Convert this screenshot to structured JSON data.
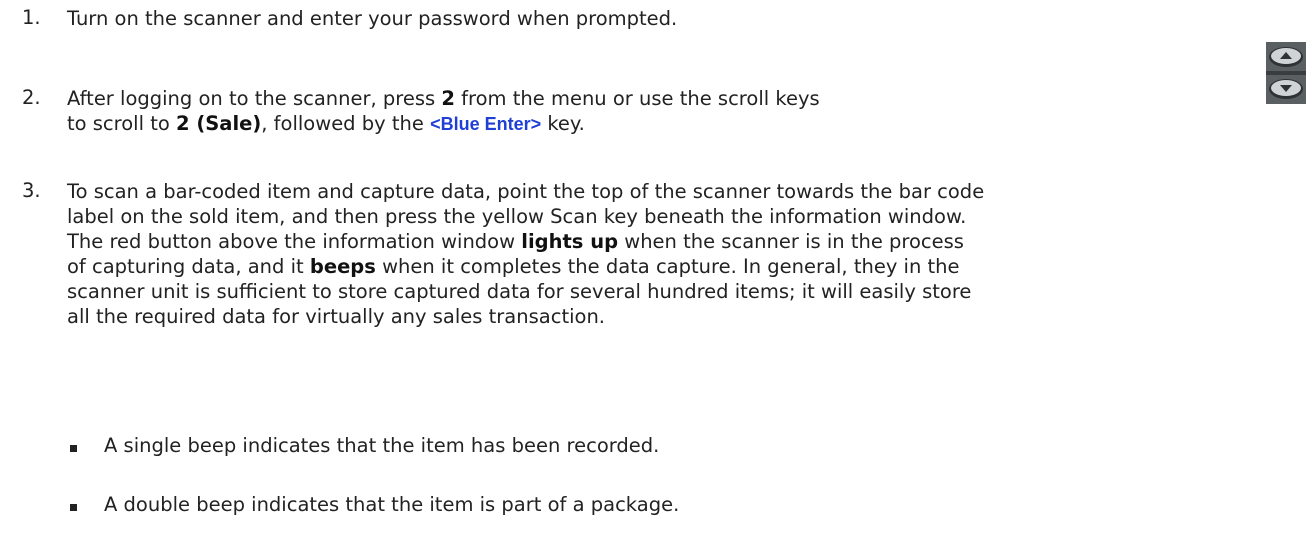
{
  "steps": [
    {
      "number": "1.",
      "lines": [
        "Turn on the scanner and enter your password when prompted."
      ]
    },
    {
      "number": "2.",
      "line1": "After logging on to the scanner, press ",
      "line1_bold": "2",
      "line1_end": " from the menu or use the scroll keys",
      "line2_a": "to scroll to ",
      "line2_bold": "2 (Sale)",
      "line2_b": ", followed by the ",
      "line2_blue": "<Blue Enter>",
      "line2_c": " key."
    },
    {
      "number": "3.",
      "l1": "To scan a bar-coded item and capture data, point the top of the scanner towards the bar code",
      "l2": "label on the sold item, and then press the yellow Scan key beneath the information window.",
      "l3_a": "The red button above the information window ",
      "l3_bold": "lights up",
      "l3_b": " when the scanner is in the process",
      "l4_a": "of capturing data, and it ",
      "l4_bold": "beeps",
      "l4_b": " when it completes the data capture. In general, they in the",
      "l5": "scanner unit is sufficient to store captured data for several hundred items; it will easily store",
      "l6": "all the required data for virtually any sales transaction."
    }
  ],
  "bullets": [
    "A single beep indicates that the item has been recorded.",
    "A double beep indicates that the item is part of a package."
  ],
  "icons": {
    "scroll_keys": "scroll-up-down-keys-icon",
    "key_bg": "#4a4f52",
    "key_face": "#cfd3d6"
  }
}
